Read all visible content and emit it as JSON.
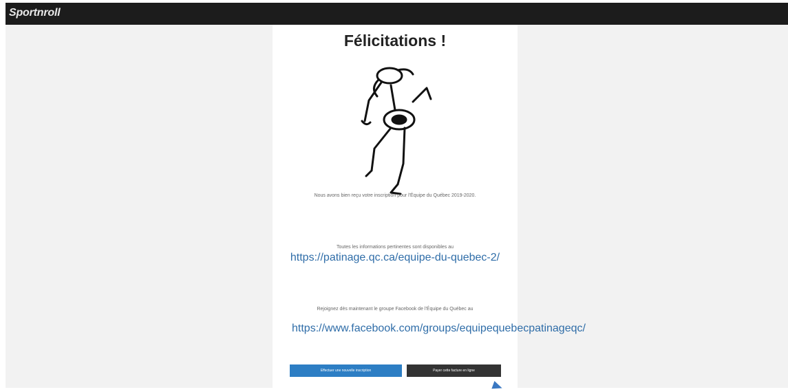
{
  "app": {
    "brand": "Sportnroll"
  },
  "card": {
    "title": "Félicitations !",
    "paragraph1": "Nous avons bien reçu votre inscription pour l'Équipe du Québec 2019-2020.",
    "paragraph2": "Toutes les informations pertinentes sont disponibles au",
    "link1": "https://patinage.qc.ca/equipe-du-quebec-2/",
    "paragraph3": "Rejoignez dès maintenant le groupe Facebook de l'Équipe du Québec au",
    "link2": "https://www.facebook.com/groups/equipequebecpatinageqc/"
  },
  "buttons": {
    "new_registration": "Effectuer une nouvelle inscription",
    "pay": "Payer cette facture en ligne"
  },
  "colors": {
    "header": "#1c1c1c",
    "link": "#2f6da8",
    "primary_button": "#2d7ec4",
    "secondary_button": "#333333"
  }
}
